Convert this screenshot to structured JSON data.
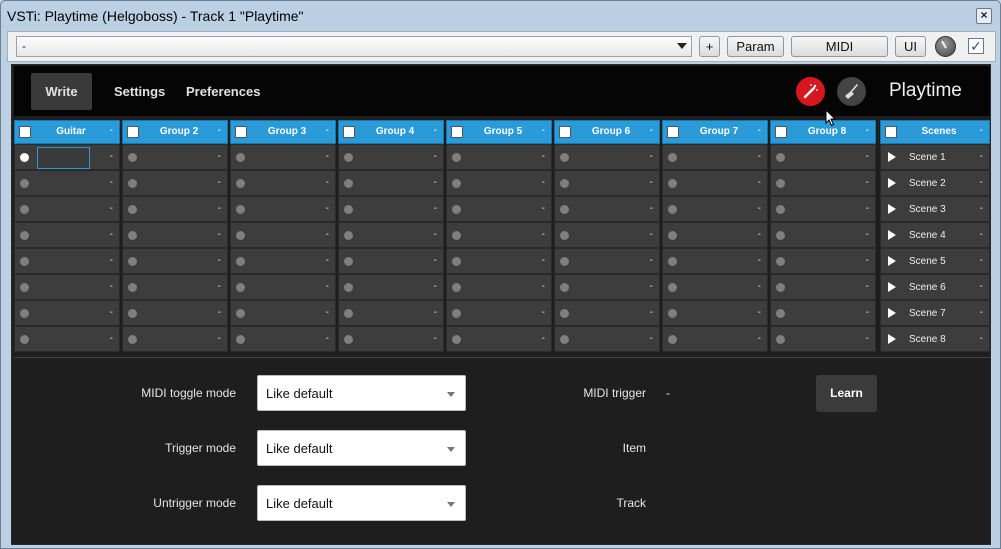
{
  "window": {
    "title": "VSTi: Playtime (Helgoboss) - Track 1 \"Playtime\"",
    "close_label": "×"
  },
  "toolbar": {
    "preset_value": "-",
    "add_label": "+",
    "param_label": "Param",
    "midi_label": "MIDI",
    "ui_label": "UI",
    "bypass_checked": "✓"
  },
  "topbar": {
    "tabs": [
      {
        "label": "Write"
      },
      {
        "label": "Settings"
      },
      {
        "label": "Preferences"
      }
    ],
    "brand": "Playtime",
    "icons": [
      "magic-wand-icon",
      "broom-icon"
    ],
    "accent_color": "#d6181e"
  },
  "grid": {
    "header_color": "#2b9ad8",
    "columns": [
      {
        "name": "Guitar",
        "dash": "-"
      },
      {
        "name": "Group 2",
        "dash": "-"
      },
      {
        "name": "Group 3",
        "dash": "-"
      },
      {
        "name": "Group 4",
        "dash": "-"
      },
      {
        "name": "Group 5",
        "dash": "-"
      },
      {
        "name": "Group 6",
        "dash": "-"
      },
      {
        "name": "Group 7",
        "dash": "-"
      },
      {
        "name": "Group 8",
        "dash": "-"
      }
    ],
    "slot_dash": "-",
    "scenes_header": {
      "name": "Scenes",
      "dash": "-"
    },
    "scenes": [
      {
        "label": "Scene 1",
        "dash": "-"
      },
      {
        "label": "Scene 2",
        "dash": "-"
      },
      {
        "label": "Scene 3",
        "dash": "-"
      },
      {
        "label": "Scene 4",
        "dash": "-"
      },
      {
        "label": "Scene 5",
        "dash": "-"
      },
      {
        "label": "Scene 6",
        "dash": "-"
      },
      {
        "label": "Scene 7",
        "dash": "-"
      },
      {
        "label": "Scene 8",
        "dash": "-"
      }
    ]
  },
  "panel": {
    "midi_toggle_label": "MIDI toggle mode",
    "midi_toggle_value": "Like default",
    "trigger_label": "Trigger mode",
    "trigger_value": "Like default",
    "untrigger_label": "Untrigger mode",
    "untrigger_value": "Like default",
    "midi_trigger_label": "MIDI trigger",
    "midi_trigger_value": "-",
    "learn_label": "Learn",
    "item_label": "Item",
    "track_label": "Track"
  }
}
